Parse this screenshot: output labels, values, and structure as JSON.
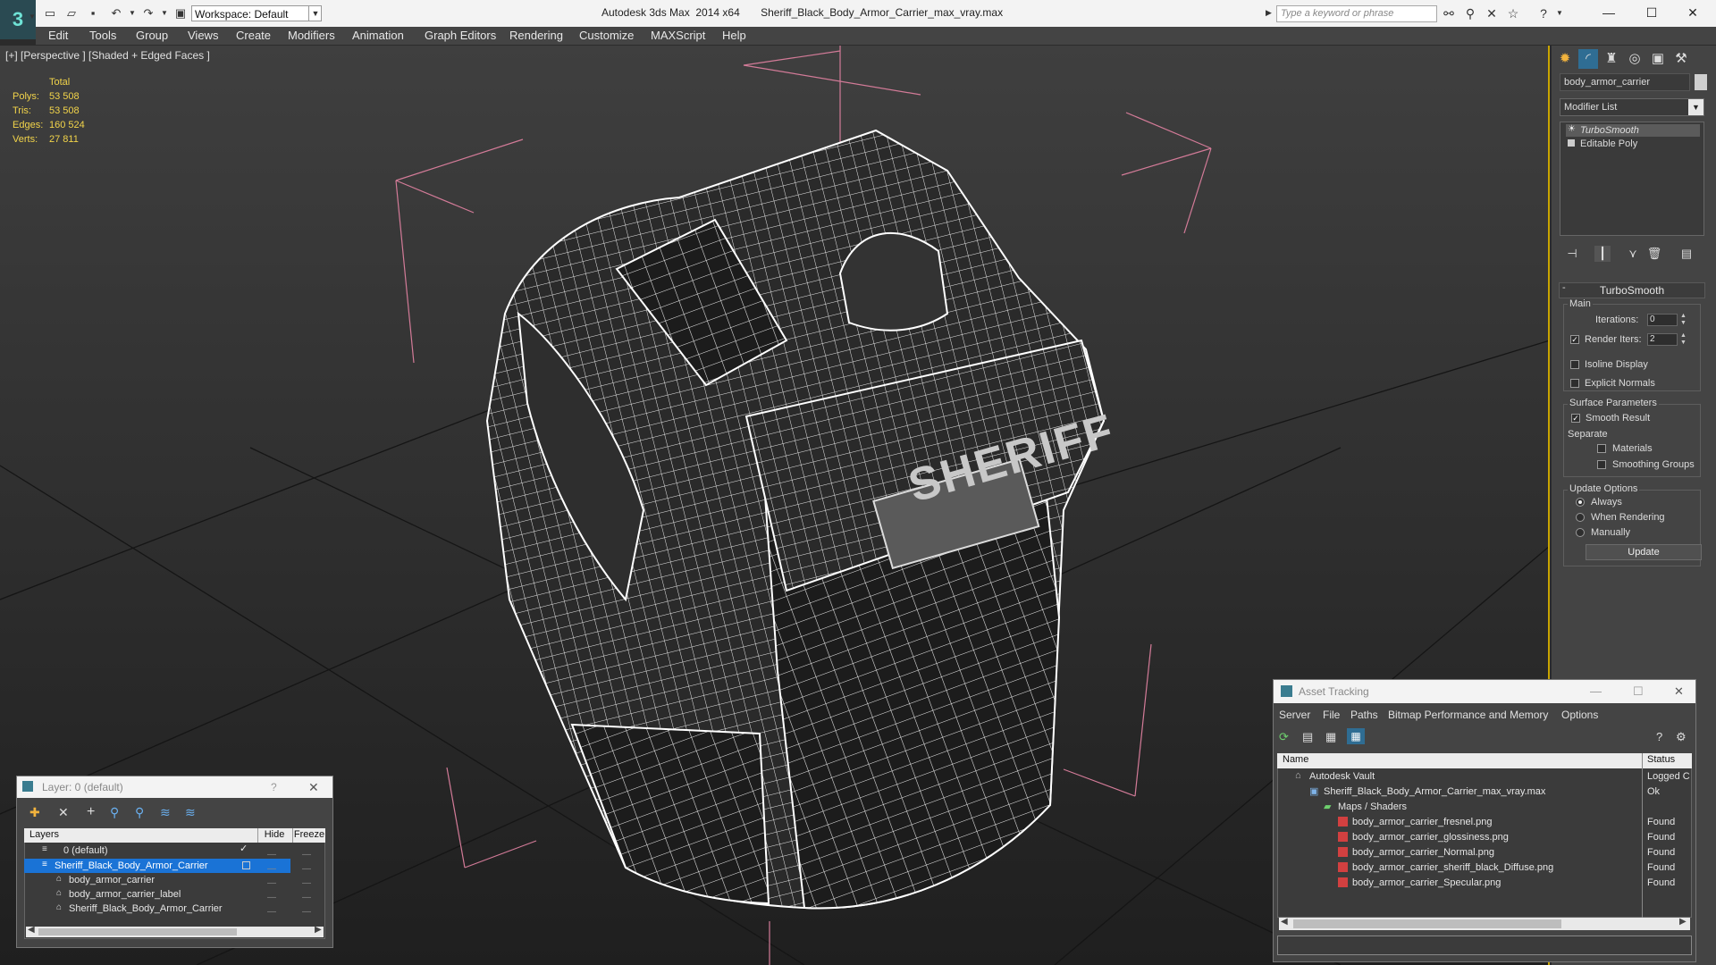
{
  "titlebar": {
    "app_logo": "3",
    "workspace": "Workspace: Default",
    "title": "Autodesk 3ds Max  2014 x64       Sheriff_Black_Body_Armor_Carrier_max_vray.max",
    "search_placeholder": "Type a keyword or phrase"
  },
  "menu": [
    "Edit",
    "Tools",
    "Group",
    "Views",
    "Create",
    "Modifiers",
    "Animation",
    "Graph Editors",
    "Rendering",
    "Customize",
    "MAXScript",
    "Help"
  ],
  "viewport": {
    "label": "[+] [Perspective ] [Shaded + Edged Faces ]",
    "stats_header": "Total",
    "stats": [
      {
        "label": "Polys:",
        "value": "53 508"
      },
      {
        "label": "Tris:",
        "value": "53 508"
      },
      {
        "label": "Edges:",
        "value": "160 524"
      },
      {
        "label": "Verts:",
        "value": "27 811"
      }
    ],
    "patch_text": "SHERIFF"
  },
  "command_panel": {
    "object_name": "body_armor_carrier",
    "modifier_list": "Modifier List",
    "stack": [
      "TurboSmooth",
      "Editable Poly"
    ],
    "rollout_title": "TurboSmooth",
    "main_label": "Main",
    "iterations_label": "Iterations:",
    "iterations_value": "0",
    "render_iters_label": "Render Iters:",
    "render_iters_value": "2",
    "isoline_label": "Isoline Display",
    "explicit_normals_label": "Explicit Normals",
    "surface_params_label": "Surface Parameters",
    "smooth_result_label": "Smooth Result",
    "separate_label": "Separate",
    "materials_label": "Materials",
    "smoothing_groups_label": "Smoothing Groups",
    "update_options_label": "Update Options",
    "always_label": "Always",
    "when_rendering_label": "When Rendering",
    "manually_label": "Manually",
    "update_button": "Update"
  },
  "layer_window": {
    "title": "Layer: 0 (default)",
    "help": "?",
    "headers": {
      "layers": "Layers",
      "hide": "Hide",
      "freeze": "Freeze"
    },
    "rows": [
      {
        "name": "0 (default)"
      },
      {
        "name": "Sheriff_Black_Body_Armor_Carrier"
      },
      {
        "name": "body_armor_carrier"
      },
      {
        "name": "body_armor_carrier_label"
      },
      {
        "name": "Sheriff_Black_Body_Armor_Carrier"
      }
    ]
  },
  "asset_window": {
    "title": "Asset Tracking",
    "menu": [
      "Server",
      "File",
      "Paths",
      "Bitmap Performance and Memory",
      "Options"
    ],
    "headers": {
      "name": "Name",
      "status": "Status"
    },
    "rows": [
      {
        "name": "Autodesk Vault",
        "status": "Logged C"
      },
      {
        "name": "Sheriff_Black_Body_Armor_Carrier_max_vray.max",
        "status": "Ok"
      },
      {
        "name": "Maps / Shaders",
        "status": ""
      },
      {
        "name": "body_armor_carrier_fresnel.png",
        "status": "Found"
      },
      {
        "name": "body_armor_carrier_glossiness.png",
        "status": "Found"
      },
      {
        "name": "body_armor_carrier_Normal.png",
        "status": "Found"
      },
      {
        "name": "body_armor_carrier_sheriff_black_Diffuse.png",
        "status": "Found"
      },
      {
        "name": "body_armor_carrier_Specular.png",
        "status": "Found"
      }
    ]
  }
}
